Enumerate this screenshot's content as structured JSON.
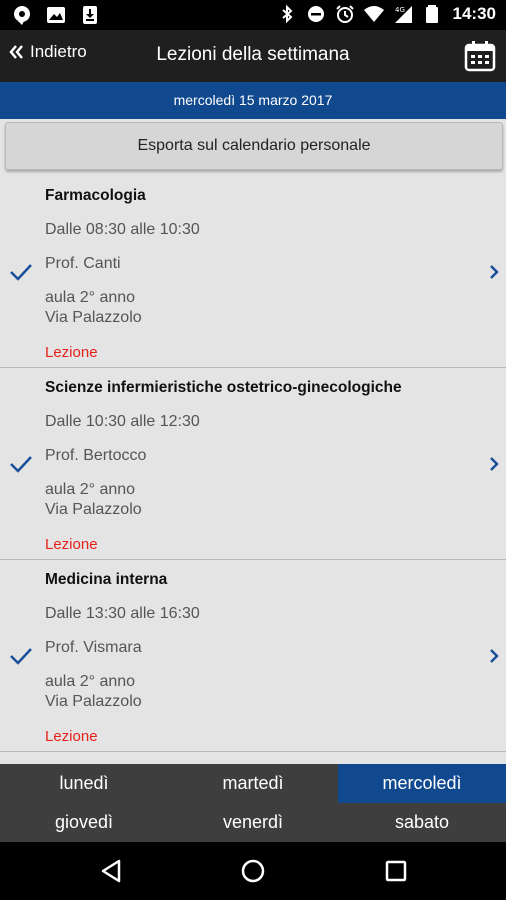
{
  "status_bar": {
    "time": "14:30",
    "left_icons": [
      "chat-bubble-icon",
      "image-icon",
      "download-icon"
    ],
    "right_icons": [
      "bluetooth-icon",
      "do-not-disturb-icon",
      "alarm-icon",
      "wifi-icon",
      "signal-4g-icon",
      "battery-icon"
    ]
  },
  "app_bar": {
    "back_label": "Indietro",
    "title": "Lezioni della settimana",
    "calendar_icon": "calendar-icon"
  },
  "date_band": "mercoledì 15 marzo 2017",
  "export_label": "Esporta sul calendario personale",
  "lessons": [
    {
      "course": "Farmacologia",
      "time": "Dalle 08:30 alle 10:30",
      "professor": "Prof. Canti",
      "room": "aula 2° anno",
      "address": "Via Palazzolo",
      "type": "Lezione"
    },
    {
      "course": "Scienze infermieristiche ostetrico-ginecologiche",
      "time": "Dalle 10:30 alle 12:30",
      "professor": "Prof. Bertocco",
      "room": "aula 2° anno",
      "address": "Via Palazzolo",
      "type": "Lezione"
    },
    {
      "course": "Medicina interna",
      "time": "Dalle 13:30 alle 16:30",
      "professor": "Prof. Vismara",
      "room": "aula 2° anno",
      "address": "Via Palazzolo",
      "type": "Lezione"
    }
  ],
  "days": [
    {
      "label": "lunedì"
    },
    {
      "label": "martedì"
    },
    {
      "label": "mercoledì",
      "selected": true
    },
    {
      "label": "giovedì"
    },
    {
      "label": "venerdì"
    },
    {
      "label": "sabato"
    }
  ],
  "colors": {
    "status_bar": "#000000",
    "app_bar": "#1f1f1f",
    "accent_blue": "#11498e",
    "lesson_type_red": "#e8201c",
    "check_blue": "#1a4f9a"
  },
  "nav_icons": [
    "back-triangle-icon",
    "home-circle-icon",
    "recents-square-icon"
  ]
}
